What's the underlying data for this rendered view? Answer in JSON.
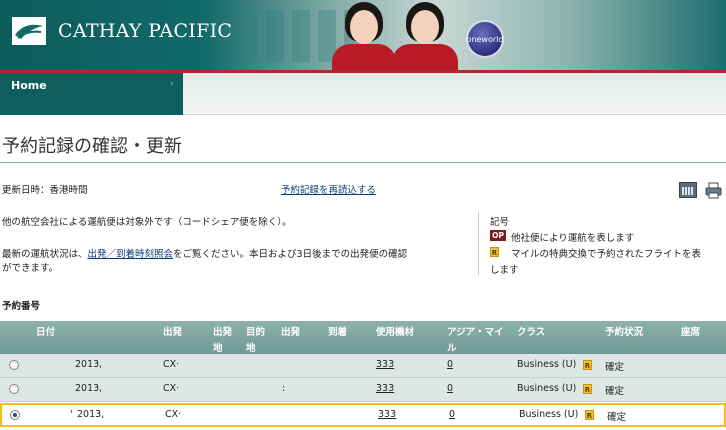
{
  "header": {
    "brand": "CATHAY PACIFIC",
    "alliance_badge": "oneworld",
    "colors": {
      "brand_teal": "#0e5e5d",
      "accent_red": "#b2272d",
      "highlight": "#f0c11a"
    }
  },
  "nav": {
    "home_label": "Home",
    "home_arrow": "›"
  },
  "page": {
    "title": "予約記録の確認・更新",
    "updated_label": "更新日時：香港時間",
    "reload_link": "予約記録を再読込する",
    "note_codeshare": "他の航空会社による運航便は対象外です（コードシェア便を除く）。",
    "note_status_prefix": "最新の運航状況は、",
    "note_status_link": "出発／到着時刻照会",
    "note_status_suffix": "をご覧ください。本日および3日後までの出発便の確認",
    "note_status_line2": "ができます。"
  },
  "legend": {
    "title": "記号",
    "op_badge": "OP",
    "op_text": "他社便により運航を表します",
    "r_badge": "R",
    "r_text_line1": "マイルの特典交換で予約されたフライトを表",
    "r_text_line2": "します"
  },
  "booking": {
    "section_label": "予約番号",
    "columns": {
      "date": "日付",
      "dep": "出発",
      "dep_place_1": "出発",
      "dep_place_2": "地",
      "arr_place_1": "目的",
      "arr_place_2": "地",
      "dep_time": "出発",
      "arr_time": "到着",
      "aircraft": "使用機材",
      "asia_miles_1": "アジア・マイ",
      "asia_miles_2": "ル",
      "cls": "クラス",
      "status": "予約状況",
      "seat": "座席"
    },
    "rows": [
      {
        "selected": false,
        "date": "2013,",
        "flight": "CX·",
        "mid": "",
        "aircraft": "333",
        "miles": "0",
        "cls": "Business (U)",
        "r_badge": "R",
        "status": "確定",
        "prefix": ""
      },
      {
        "selected": false,
        "date": "2013,",
        "flight": "CX·",
        "mid": ":",
        "aircraft": "333",
        "miles": "0",
        "cls": "Business (U)",
        "r_badge": "R",
        "status": "確定",
        "prefix": ""
      },
      {
        "selected": true,
        "date": "2013,",
        "flight": "CX·",
        "mid": "",
        "aircraft": "333",
        "miles": "0",
        "cls": "Business (U)",
        "r_badge": "R",
        "status": "確定",
        "prefix": "'"
      }
    ]
  },
  "icons": {
    "calendar_add": "calendar-add-icon",
    "print": "print-icon"
  }
}
